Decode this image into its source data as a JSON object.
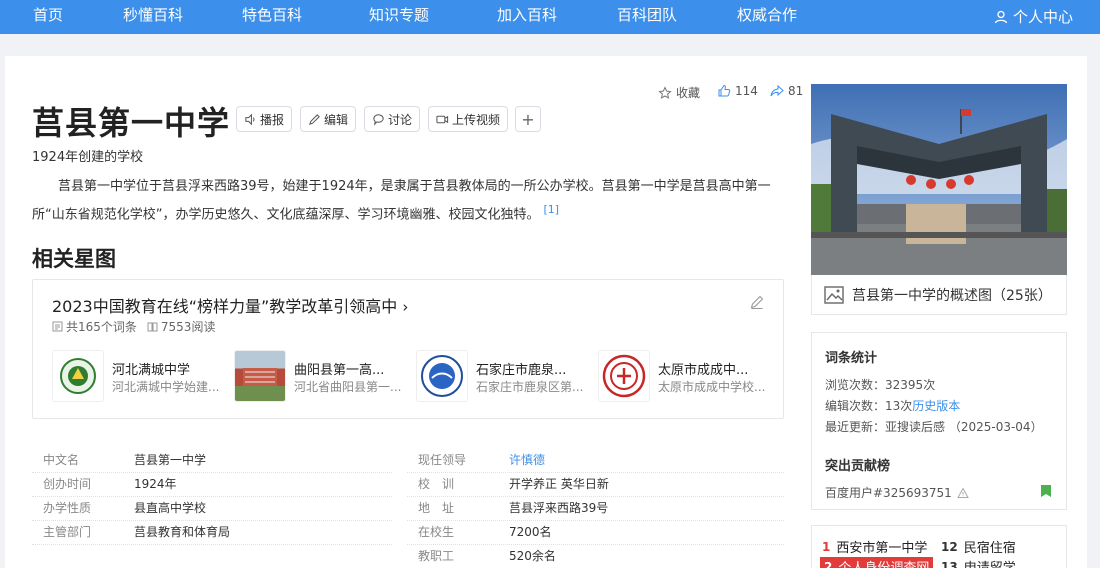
{
  "nav": {
    "items": [
      "首页",
      "秒懂百科",
      "特色百科",
      "知识专题",
      "加入百科",
      "百科团队",
      "权威合作"
    ],
    "user_center": "个人中心"
  },
  "entry": {
    "title": "莒县第一中学",
    "subtitle": "1924年创建的学校",
    "summary": "莒县第一中学位于莒县浮来西路39号，始建于1924年，是隶属于莒县教体局的一所公办学校。莒县第一中学是莒县高中第一所“山东省规范化学校”，办学历史悠久、文化底蕴深厚、学习环境幽雅、校园文化独特。",
    "ref": "[1]"
  },
  "actions": {
    "broadcast": "播报",
    "edit": "编辑",
    "discuss": "讨论",
    "upload_video": "上传视频",
    "add": "+"
  },
  "meta": {
    "favorite": "收藏",
    "likes": "114",
    "shares": "81"
  },
  "star_section": {
    "heading": "相关星图",
    "title": "2023中国教育在线“榜样力量”教学改革引领高中",
    "count": "共165个词条",
    "reads": "7553阅读",
    "items": [
      {
        "name": "河北满城中学",
        "desc": "河北满城中学始建..."
      },
      {
        "name": "曲阳县第一高...",
        "desc": "河北省曲阳县第一..."
      },
      {
        "name": "石家庄市鹿泉...",
        "desc": "石家庄市鹿泉区第..."
      },
      {
        "name": "太原市成成中...",
        "desc": "太原市成成中学校..."
      }
    ]
  },
  "basic_info": {
    "left": [
      {
        "k": "中文名",
        "v": "莒县第一中学"
      },
      {
        "k": "创办时间",
        "v": "1924年"
      },
      {
        "k": "办学性质",
        "v": "县直高中学校"
      },
      {
        "k": "主管部门",
        "v": "莒县教育和体育局"
      }
    ],
    "right": [
      {
        "k": "现任领导",
        "v": "许慎德"
      },
      {
        "k": "校　训",
        "v": "开学养正 英华日新"
      },
      {
        "k": "地　址",
        "v": "莒县浮来西路39号"
      },
      {
        "k": "在校生",
        "v": "7200名"
      },
      {
        "k": "教职工",
        "v": "520余名"
      }
    ]
  },
  "sidebar": {
    "photo_caption": "莒县第一中学的概述图（25张）",
    "stats_heading": "词条统计",
    "views_label": "浏览次数：",
    "views": "32395次",
    "edits_label": "编辑次数：",
    "edits": "13次",
    "history_link": "历史版本",
    "updated_label": "最近更新：",
    "updated": "亚搜读后感 （2025-03-04）",
    "contrib_heading": "突出贡献榜",
    "contributor": "百度用户#325693751",
    "hot": [
      {
        "n": "1",
        "t": "西安市第一中学"
      },
      {
        "n": "12",
        "t": "民宿住宿"
      },
      {
        "n": "2",
        "t": "个人身份调查网"
      },
      {
        "n": "13",
        "t": "申请留学"
      }
    ]
  },
  "colors": {
    "brand": "#3c8fea",
    "hot_red": "#e23b3b"
  }
}
